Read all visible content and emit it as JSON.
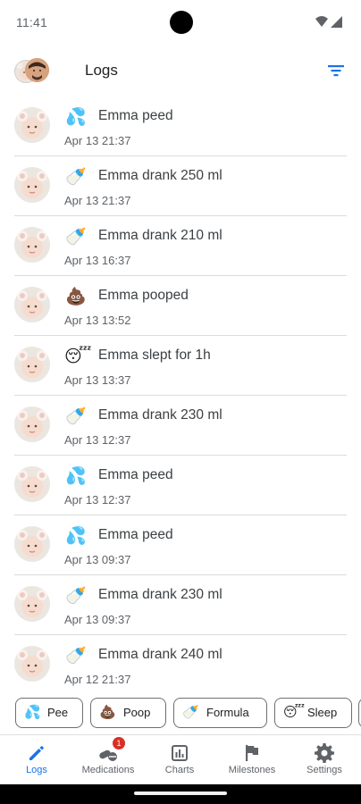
{
  "status_bar": {
    "time": "11:41"
  },
  "app_bar": {
    "title": "Logs",
    "filter_icon": "filter-icon"
  },
  "logs": [
    {
      "emoji": "💦",
      "text": "Emma peed",
      "time": "Apr 13 21:37",
      "kind": "pee"
    },
    {
      "emoji": "🍼",
      "text": "Emma drank 250 ml",
      "time": "Apr 13 21:37",
      "kind": "formula"
    },
    {
      "emoji": "🍼",
      "text": "Emma drank 210 ml",
      "time": "Apr 13 16:37",
      "kind": "formula"
    },
    {
      "emoji": "💩",
      "text": "Emma pooped",
      "time": "Apr 13 13:52",
      "kind": "poop"
    },
    {
      "emoji": "😴",
      "text": "Emma slept for 1h",
      "time": "Apr 13 13:37",
      "kind": "sleep"
    },
    {
      "emoji": "🍼",
      "text": "Emma drank 230 ml",
      "time": "Apr 13 12:37",
      "kind": "formula"
    },
    {
      "emoji": "💦",
      "text": "Emma peed",
      "time": "Apr 13 12:37",
      "kind": "pee"
    },
    {
      "emoji": "💦",
      "text": "Emma peed",
      "time": "Apr 13 09:37",
      "kind": "pee"
    },
    {
      "emoji": "🍼",
      "text": "Emma drank 230 ml",
      "time": "Apr 13 09:37",
      "kind": "formula"
    },
    {
      "emoji": "🍼",
      "text": "Emma drank 240 ml",
      "time": "Apr 12 21:37",
      "kind": "formula"
    }
  ],
  "quick_add": [
    {
      "emoji": "💦",
      "label": "Pee"
    },
    {
      "emoji": "💩",
      "label": "Poop"
    },
    {
      "emoji": "🍼",
      "label": "Formula"
    },
    {
      "emoji": "😴",
      "label": "Sleep"
    }
  ],
  "bottom_nav": {
    "items": [
      {
        "label": "Logs",
        "icon": "pencil-icon",
        "active": true
      },
      {
        "label": "Medications",
        "icon": "pills-icon",
        "badge": "1"
      },
      {
        "label": "Charts",
        "icon": "chart-icon"
      },
      {
        "label": "Milestones",
        "icon": "flag-icon"
      },
      {
        "label": "Settings",
        "icon": "gear-icon"
      }
    ]
  },
  "colors": {
    "accent": "#1a73e8",
    "badge": "#d93025",
    "divider": "#dcdcdc"
  }
}
